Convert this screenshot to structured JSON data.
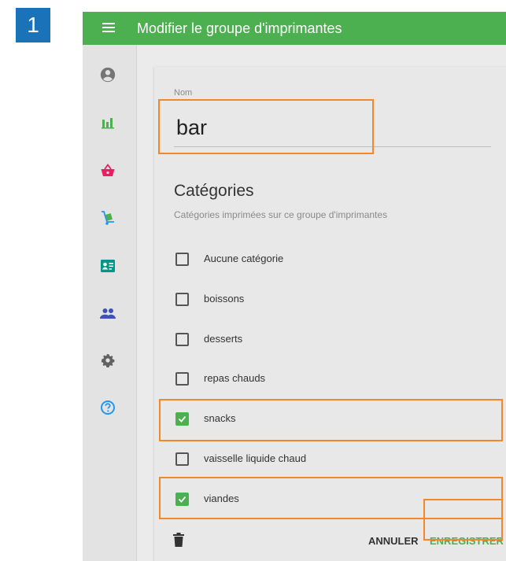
{
  "step_badge": "1",
  "appbar": {
    "title": "Modifier le groupe d'imprimantes",
    "color": "#4caf50"
  },
  "sidebar": {
    "items": [
      {
        "icon": "account-circle-icon",
        "color": "#757575"
      },
      {
        "icon": "bar-chart-icon",
        "color": "#4caf50"
      },
      {
        "icon": "shopping-basket-icon",
        "color": "#e91e63"
      },
      {
        "icon": "hand-truck-icon",
        "color": "#2196f3"
      },
      {
        "icon": "contact-card-icon",
        "color": "#009688"
      },
      {
        "icon": "people-icon",
        "color": "#3f51b5"
      },
      {
        "icon": "gear-icon",
        "color": "#616161"
      },
      {
        "icon": "help-circle-icon",
        "color": "#2196f3"
      }
    ]
  },
  "form": {
    "name_label": "Nom",
    "name_value": "bar",
    "categories_title": "Catégories",
    "categories_subtitle": "Catégories imprimées sur ce groupe d'imprimantes",
    "categories": [
      {
        "label": "Aucune catégorie",
        "checked": false
      },
      {
        "label": "boissons",
        "checked": false
      },
      {
        "label": "desserts",
        "checked": false
      },
      {
        "label": "repas chauds",
        "checked": false
      },
      {
        "label": "snacks",
        "checked": true
      },
      {
        "label": "vaisselle liquide chaud",
        "checked": false
      },
      {
        "label": "viandes",
        "checked": true
      }
    ]
  },
  "actions": {
    "cancel_label": "ANNULER",
    "save_label": "ENREGISTRER"
  },
  "highlight_color": "#f2882d"
}
